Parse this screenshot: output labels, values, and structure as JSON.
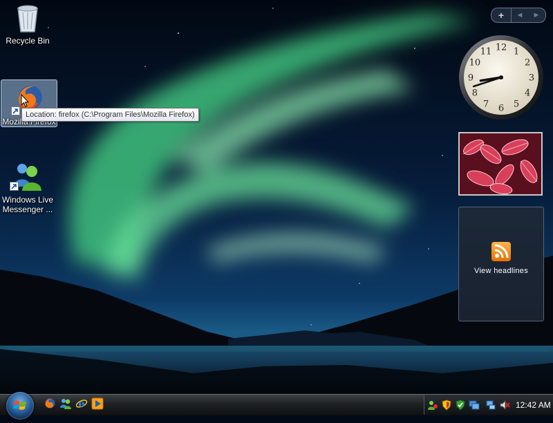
{
  "desktop": {
    "icons": [
      {
        "label": "Recycle Bin",
        "icon": "recycle-bin-icon"
      },
      {
        "label": "Mozilla Firefox",
        "icon": "firefox-icon"
      },
      {
        "label": "Windows Live Messenger ...",
        "icon": "windows-live-messenger-icon"
      }
    ],
    "tooltip": "Location: firefox (C:\\Program Files\\Mozilla Firefox)"
  },
  "sidebar": {
    "add_label": "+",
    "prev_label": "◄",
    "next_label": "►",
    "clock": {
      "hour": 8,
      "minute": 42
    },
    "feed": {
      "label": "View headlines",
      "icon": "rss-icon"
    }
  },
  "taskbar": {
    "start": "windows-start-orb",
    "quick_launch": [
      "firefox-icon",
      "messenger-icon",
      "internet-explorer-icon",
      "media-player-icon"
    ],
    "tray_icons": [
      "messenger-status-icon",
      "security-shield-icon",
      "windows-defender-icon",
      "network-icon",
      "network-connection-icon",
      "volume-muted-icon"
    ],
    "time": "12:42 AM"
  },
  "colors": {
    "aurora": "#4fd08c",
    "sky": "#06163a",
    "taskbar": "#1f2224",
    "rss": "#f08c1a"
  }
}
